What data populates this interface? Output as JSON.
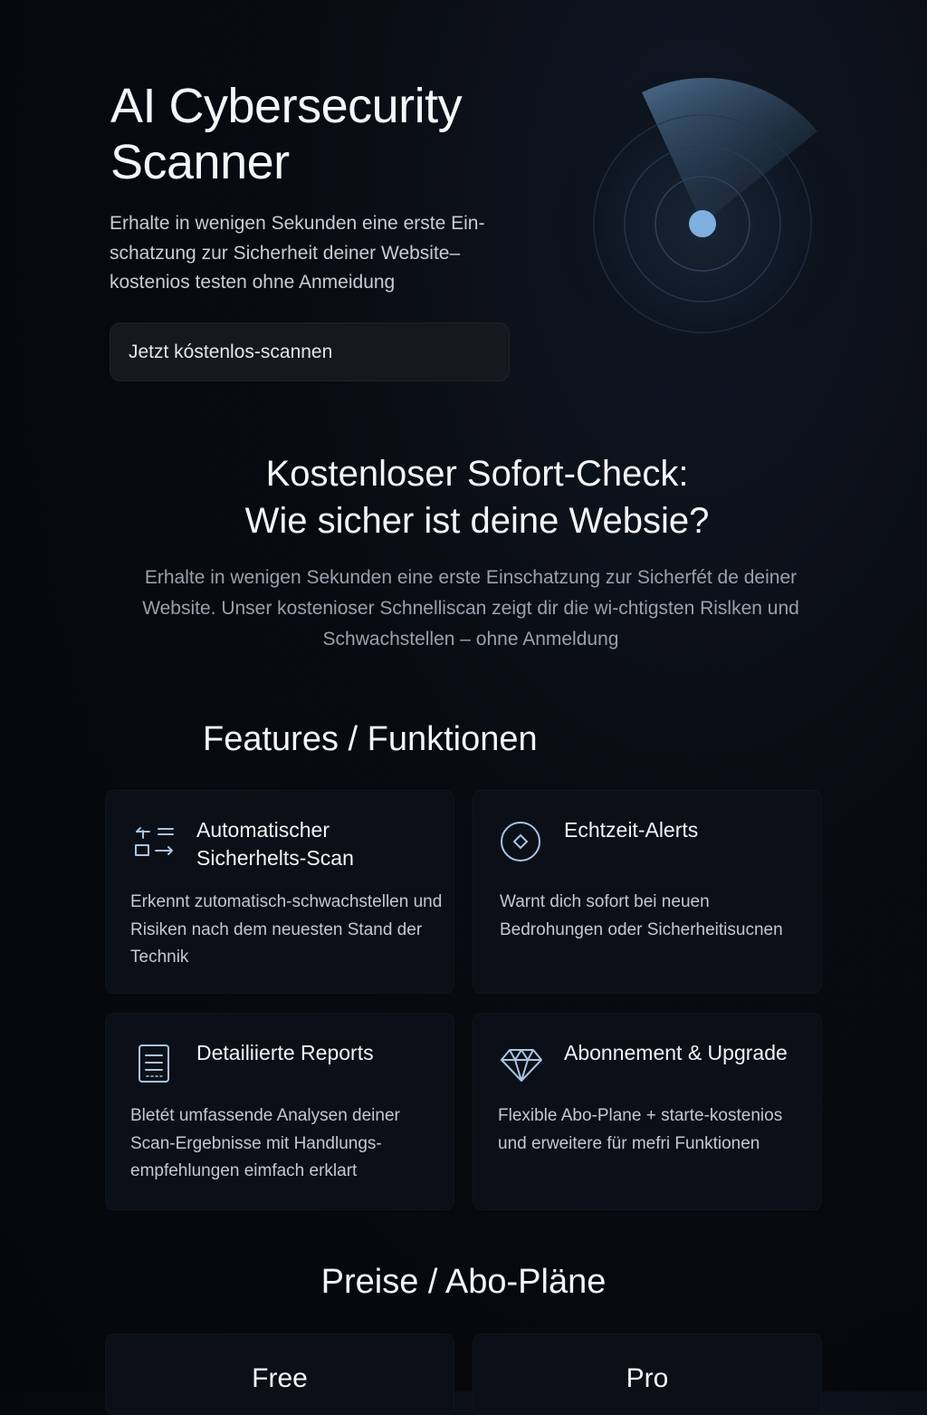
{
  "hero": {
    "title": "AI Cybersecurity Scanner",
    "subtitle": "Erhalte in wenigen Sekunden eine erste Ein-schatzung zur Sicherheit deiner Website– kostenios testen ohne Anmeidung",
    "cta_label": "Jetzt kóstenlos-scannen",
    "radar_icon": "radar-scan-icon"
  },
  "check": {
    "title_line1": "Kostenloser Sofort-Check:",
    "title_line2": "Wie sicher ist deine Websie?",
    "text": "Erhalte in wenigen Sekunden eine erste Einschatzung zur Sicherfét de deiner Website. Unser kostenioser Schnelliscan zeigt dir die wi-chtigsten Rislken und Schwachstellen – ohne Anmeldung"
  },
  "features": {
    "title": "Features / Funktionen",
    "items": [
      {
        "icon": "scan-arrows-icon",
        "title": "Automatischer Sicherhelts-Scan",
        "description": "Erkennt zutomatisch-schwachstellen und Risiken nach dem neuesten Stand der Technik"
      },
      {
        "icon": "alert-diamond-icon",
        "title": "Echtzeit-Alerts",
        "description": "Warnt dich sofort bei neuen Bedrohungen oder Sicherheitisucnen"
      },
      {
        "icon": "document-report-icon",
        "title": "Detailiierte Reports",
        "description": "Bletét umfassende Analysen deiner Scan-Ergebnisse mit Handlungs-empfehlungen eimfach erklart"
      },
      {
        "icon": "gem-icon",
        "title": "Abonnement & Upgrade",
        "description": "Flexible Abo-Plane + starte-kostenios und erweitere für mefri Funktionen"
      }
    ]
  },
  "pricing": {
    "title": "Preise / Abo-Pläne",
    "plans": [
      {
        "name": "Free"
      },
      {
        "name": "Pro"
      }
    ]
  },
  "colors": {
    "background": "#05070b",
    "card": "#0b0f17",
    "accent": "#7fb0e0",
    "text": "#f3f5f8",
    "muted": "#9aa1ad"
  }
}
